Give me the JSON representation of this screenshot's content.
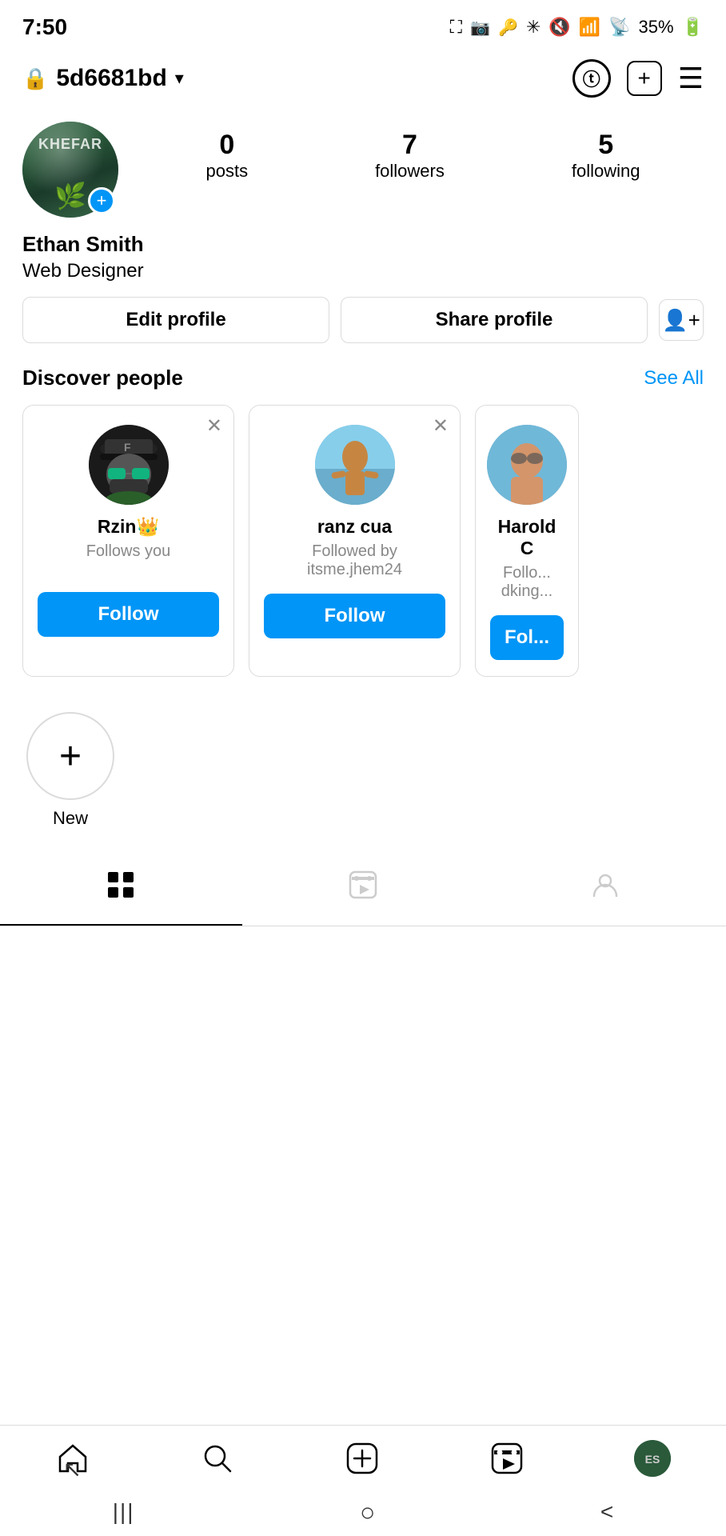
{
  "statusBar": {
    "time": "7:50",
    "battery": "35%",
    "icons": [
      "bluetooth",
      "mute",
      "wifi",
      "signal",
      "battery"
    ]
  },
  "header": {
    "username": "5d6681bd",
    "lockIcon": "🔒",
    "threadsIcon": "Ⓣ",
    "addIcon": "+",
    "menuIcon": "☰"
  },
  "profile": {
    "name": "Ethan Smith",
    "bio": "Web Designer",
    "stats": {
      "posts": {
        "count": "0",
        "label": "posts"
      },
      "followers": {
        "count": "7",
        "label": "followers"
      },
      "following": {
        "count": "5",
        "label": "following"
      }
    },
    "buttons": {
      "edit": "Edit profile",
      "share": "Share profile"
    }
  },
  "discover": {
    "title": "Discover people",
    "seeAll": "See All",
    "people": [
      {
        "name": "Rzin👑",
        "sub": "Follows you",
        "followLabel": "Follow"
      },
      {
        "name": "ranz cua",
        "sub": "Followed by itsme.jhem24",
        "followLabel": "Follow"
      },
      {
        "name": "Harold C",
        "sub": "Follo... dking...",
        "followLabel": "Fol..."
      }
    ]
  },
  "stories": {
    "newLabel": "New",
    "newIcon": "+"
  },
  "contentTabs": {
    "grid": "⊞",
    "reels": "▶",
    "tagged": "👤"
  },
  "bottomNav": {
    "home": "🏠",
    "search": "🔍",
    "add": "⊕",
    "reels": "▶",
    "profile": "ES"
  },
  "androidNav": {
    "menu": "|||",
    "home": "○",
    "back": "<"
  }
}
